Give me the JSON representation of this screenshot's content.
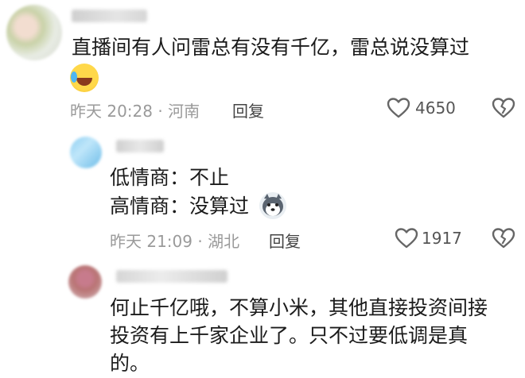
{
  "comments": [
    {
      "text_lines": [
        "直播间有人问雷总有没有千亿，雷总说没算过"
      ],
      "time_location": "昨天 20:28 · 河南",
      "reply_label": "回复",
      "like_count": "4650"
    },
    {
      "text_lines": [
        "低情商：不止",
        "高情商：没算过"
      ],
      "time_location": "昨天 21:09 · 湖北",
      "reply_label": "回复",
      "like_count": "1917"
    },
    {
      "text_lines": [
        "何止千亿哦，不算小米，其他直接投资间接",
        "投资有上千家企业了。只不过要低调是真",
        "的。"
      ]
    }
  ],
  "icons": [
    "tears-of-joy-emoji",
    "husky-emoji",
    "heart-icon",
    "broken-heart-icon"
  ],
  "colors": {
    "text": "#1b1b1b",
    "meta": "#9a9a9a",
    "icon": "#666666"
  }
}
